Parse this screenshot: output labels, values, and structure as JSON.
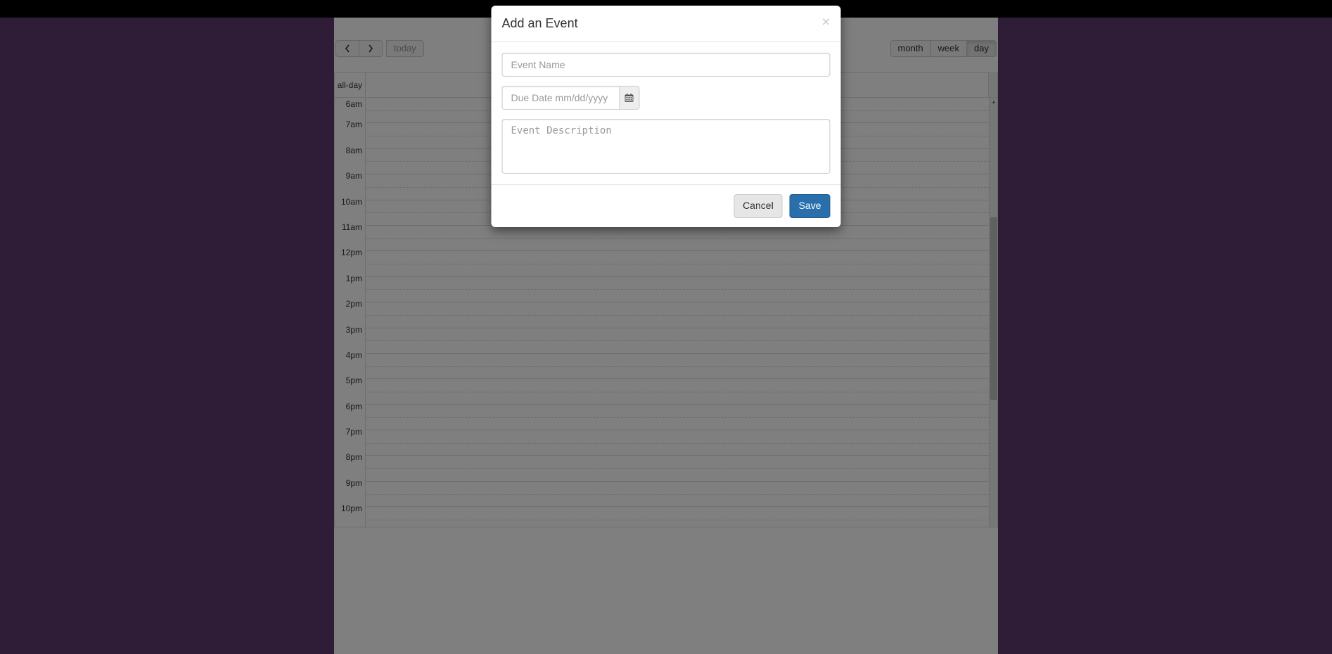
{
  "toolbar": {
    "today_label": "today",
    "views": {
      "month": "month",
      "week": "week",
      "day": "day"
    },
    "active_view": "day"
  },
  "calendar": {
    "allday_label": "all-day",
    "hours": [
      "6am",
      "7am",
      "8am",
      "9am",
      "10am",
      "11am",
      "12pm",
      "1pm",
      "2pm",
      "3pm",
      "4pm",
      "5pm",
      "6pm",
      "7pm",
      "8pm",
      "9pm",
      "10pm"
    ]
  },
  "modal": {
    "title": "Add an Event",
    "name_placeholder": "Event Name",
    "date_placeholder": "Due Date mm/dd/yyyy",
    "desc_placeholder": "Event Description",
    "cancel_label": "Cancel",
    "save_label": "Save",
    "close_char": "×"
  }
}
